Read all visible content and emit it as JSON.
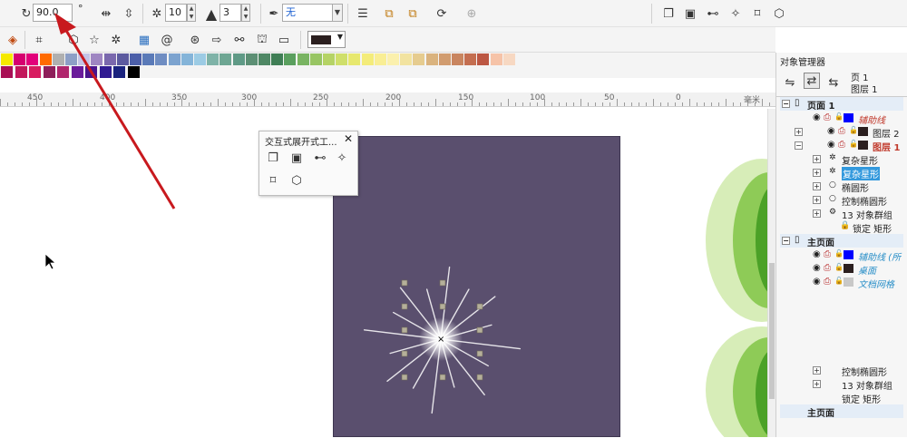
{
  "toolbar": {
    "rotation_value": "90.0",
    "degree_symbol": "°",
    "points_value": "10",
    "sharpness_value": "3",
    "outline_value": "无"
  },
  "ruler": {
    "labels": [
      "450",
      "400",
      "350",
      "300",
      "250",
      "200",
      "150",
      "100",
      "50",
      "0",
      "毫米"
    ]
  },
  "flyout": {
    "title": "交互式展开式工...",
    "close": "✕"
  },
  "panel": {
    "title": "对象管理器",
    "page_label": "页 1",
    "layer_label": "图层 1",
    "tree": [
      {
        "text": "页面 1",
        "header": true
      },
      {
        "text": "辅助线",
        "color": "#0000ff",
        "style": "italic-red"
      },
      {
        "text": "图层 2",
        "color": "#2b1f1f",
        "style": "normal"
      },
      {
        "text": "图层 1",
        "color": "#2b1f1f",
        "style": "bold-red"
      },
      {
        "text": "复杂星形",
        "style": "normal"
      },
      {
        "text": "复杂星形",
        "style": "selected"
      },
      {
        "text": "椭圆形",
        "style": "normal"
      },
      {
        "text": "控制椭圆形",
        "style": "normal"
      },
      {
        "text": "13 对象群组",
        "style": "normal"
      },
      {
        "text": "锁定 矩形",
        "style": "normal"
      },
      {
        "text": "主页面",
        "header": true
      },
      {
        "text": "辅助线 (所",
        "color": "#0000ff",
        "style": "italic-blue"
      },
      {
        "text": "桌面",
        "color": "#2b1f1f",
        "style": "italic-blue"
      },
      {
        "text": "文档网格",
        "color": "#c8c8c8",
        "style": "italic-blue"
      }
    ],
    "tree_lower": [
      {
        "text": "控制椭圆形"
      },
      {
        "text": "13 对象群组"
      },
      {
        "text": "锁定 矩形"
      },
      {
        "text": "主页面",
        "header": true
      }
    ]
  },
  "colors": {
    "page_fill": "#5a4f6e",
    "annotation_arrow": "#c8191e",
    "selection": "#3399dd"
  }
}
